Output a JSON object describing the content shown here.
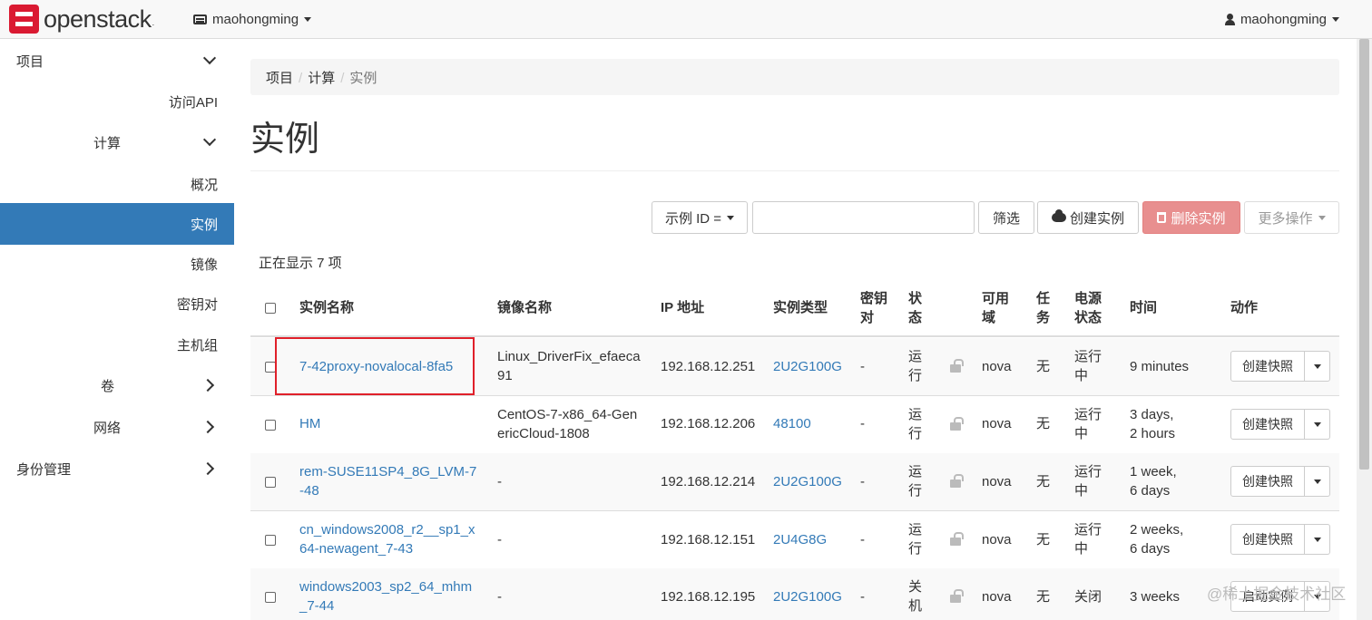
{
  "nav": {
    "logo_text": "openstack",
    "logo_reg": ".",
    "project": "maohongming",
    "user": "maohongming"
  },
  "sidebar": {
    "project": "项目",
    "api_access": "访问API",
    "compute": "计算",
    "overview": "概况",
    "instances": "实例",
    "images": "镜像",
    "keypairs": "密钥对",
    "server_groups": "主机组",
    "volumes": "卷",
    "network": "网络",
    "identity": "身份管理"
  },
  "breadcrumb": {
    "item1": "项目",
    "item2": "计算",
    "current": "实例",
    "sep": "/"
  },
  "page_title": "实例",
  "toolbar": {
    "filter_field": "示例 ID =",
    "filter_value": "",
    "filter_button": "筛选",
    "launch_button": "创建实例",
    "delete_button": "删除实例",
    "more_button": "更多操作"
  },
  "count_text": "正在显示 7 项",
  "table": {
    "headers": {
      "name": "实例名称",
      "image": "镜像名称",
      "ip": "IP 地址",
      "flavor": "实例类型",
      "keypair_1": "密钥",
      "keypair_2": "对",
      "status_1": "状",
      "status_2": "态",
      "az_1": "可用",
      "az_2": "域",
      "task_1": "任",
      "task_2": "务",
      "power_1": "电源",
      "power_2": "状态",
      "time": "时间",
      "actions": "动作"
    },
    "rows": [
      {
        "name_1": "7-42proxy-novalocal-8fa5",
        "name_2": "",
        "image_1": "Linux_DriverFix_efaeca",
        "image_2": "91",
        "ip": "192.168.12.251",
        "flavor": "2U2G100G",
        "keypair": "-",
        "status_1": "运",
        "status_2": "行",
        "az": "nova",
        "task": "无",
        "power_1": "运行",
        "power_2": "中",
        "time_1": "9 minutes",
        "time_2": "",
        "action": "创建快照"
      },
      {
        "name_1": "HM",
        "name_2": "",
        "image_1": "CentOS-7-x86_64-Gen",
        "image_2": "ericCloud-1808",
        "ip": "192.168.12.206",
        "flavor": "48100",
        "keypair": "-",
        "status_1": "运",
        "status_2": "行",
        "az": "nova",
        "task": "无",
        "power_1": "运行",
        "power_2": "中",
        "time_1": "3 days,",
        "time_2": "2 hours",
        "action": "创建快照"
      },
      {
        "name_1": "rem-SUSE11SP4_8G_LVM-7",
        "name_2": "-48",
        "image_1": "-",
        "image_2": "",
        "ip": "192.168.12.214",
        "flavor": "2U2G100G",
        "keypair": "-",
        "status_1": "运",
        "status_2": "行",
        "az": "nova",
        "task": "无",
        "power_1": "运行",
        "power_2": "中",
        "time_1": "1 week,",
        "time_2": "6 days",
        "action": "创建快照"
      },
      {
        "name_1": "cn_windows2008_r2__sp1_x",
        "name_2": "64-newagent_7-43",
        "image_1": "-",
        "image_2": "",
        "ip": "192.168.12.151",
        "flavor": "2U4G8G",
        "keypair": "-",
        "status_1": "运",
        "status_2": "行",
        "az": "nova",
        "task": "无",
        "power_1": "运行",
        "power_2": "中",
        "time_1": "2 weeks,",
        "time_2": "6 days",
        "action": "创建快照"
      },
      {
        "name_1": "windows2003_sp2_64_mhm",
        "name_2": "_7-44",
        "image_1": "-",
        "image_2": "",
        "ip": "192.168.12.195",
        "flavor": "2U2G100G",
        "keypair": "-",
        "status_1": "关",
        "status_2": "机",
        "az": "nova",
        "task": "无",
        "power_1": "关闭",
        "power_2": "",
        "time_1": "3 weeks",
        "time_2": "",
        "action": "启动实例"
      }
    ]
  },
  "watermark": "@稀土掘金技术社区"
}
